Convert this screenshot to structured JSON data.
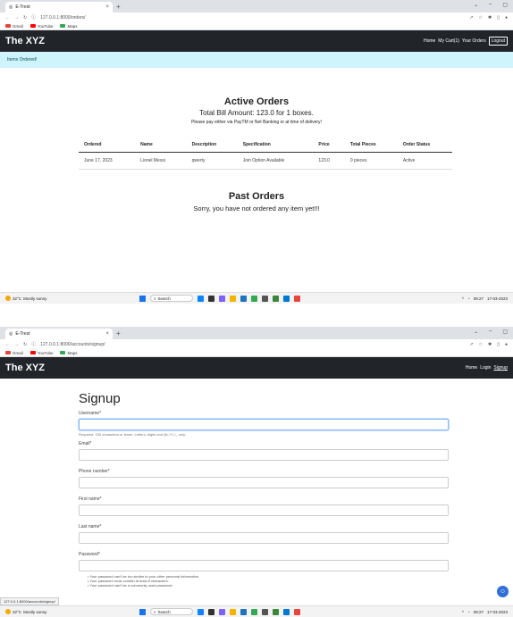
{
  "screen1": {
    "browser": {
      "tab_title": "E-Trest",
      "url": "127.0.0.1:8000/orders/",
      "bookmarks": [
        "Gmail",
        "YouTube",
        "Maps"
      ]
    },
    "navbar": {
      "brand": "The XYZ",
      "links": [
        "Home",
        "My Cart(1)",
        "Your Orders"
      ],
      "logout": "Logout"
    },
    "alert": "Items Ordered!",
    "active": {
      "heading": "Active Orders",
      "total": "Total Bill Amount: 123.0 for 1 boxes.",
      "note": "Please pay either via PayTM or Net Banking or at time of delivery!",
      "columns": [
        "Ordered",
        "Name",
        "Description",
        "Specification",
        "Price",
        "Total Pieces",
        "Order Status"
      ],
      "rows": [
        [
          "June 17, 2023",
          "Lionel Messi",
          "qwerty",
          "Join Option Available",
          "123.0",
          "0 pieces",
          "Active"
        ]
      ]
    },
    "past": {
      "heading": "Past Orders",
      "message": "Sorry, you have not ordered any item yet!!!"
    },
    "taskbar": {
      "temp": "32°C",
      "weather": "Mostly sunny",
      "search": "Search",
      "time": "09:27",
      "date": "17-03-2023"
    }
  },
  "screen2": {
    "browser": {
      "tab_title": "E-Trest",
      "url": "127.0.0.1:8000/accounts/signup/",
      "bookmarks": [
        "Gmail",
        "YouTube",
        "Maps"
      ]
    },
    "navbar": {
      "brand": "The XYZ",
      "links": [
        "Home",
        "Login",
        "Signup"
      ]
    },
    "signup": {
      "heading": "Signup",
      "username_label": "Username*",
      "username_help": "Required. 150 characters or fewer. Letters, digits and @/./+/-/_ only.",
      "email_label": "Email*",
      "phone_label": "Phone number*",
      "first_name_label": "First name*",
      "last_name_label": "Last name*",
      "password_label": "Password*",
      "password_help": [
        "Your password can't be too similar to your other personal information.",
        "Your password must contain at least 8 characters.",
        "Your password can't be a commonly used password."
      ]
    },
    "status_url": "127.0.0.1:8000/accounts/signup/",
    "taskbar": {
      "temp": "32°C",
      "weather": "Mostly sunny",
      "search": "Search",
      "time": "09:27",
      "date": "17-03-2023"
    }
  },
  "colors": {
    "navbar": "#212529",
    "alert_bg": "#cff4fc",
    "focus": "#86b7fe",
    "chat": "#2f6fd6"
  }
}
